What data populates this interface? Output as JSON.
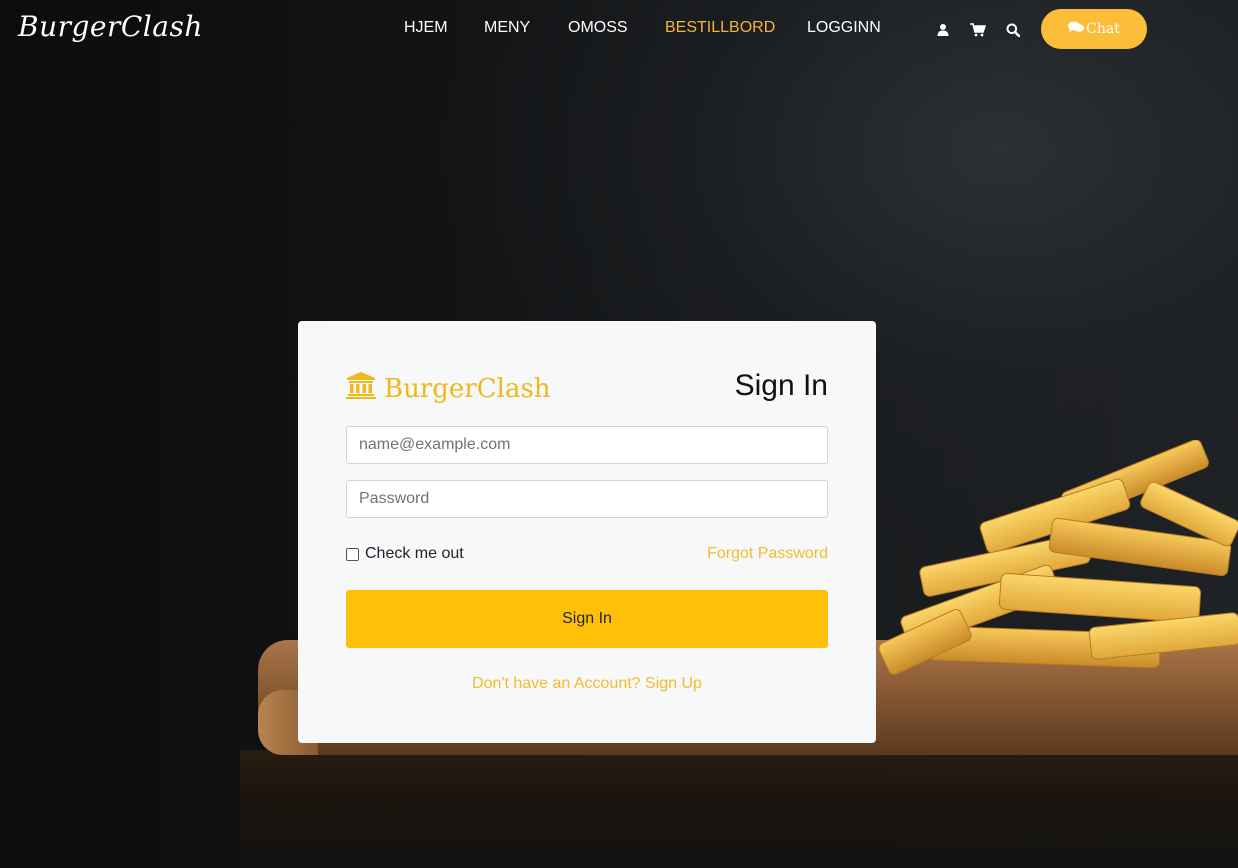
{
  "header": {
    "brand": "BurgerClash",
    "nav": [
      "HJEM",
      "MENY",
      "OMOSS",
      "BESTILLBORD",
      "LOGGINN"
    ],
    "active_nav": "BESTILLBORD",
    "icons": [
      "user-icon",
      "cart-icon",
      "search-icon"
    ],
    "chat_label": "Chat"
  },
  "card": {
    "logo_text": "BurgerClash",
    "title": "Sign In",
    "email_placeholder": "name@example.com",
    "password_placeholder": "Password",
    "remember_label": "Check me out",
    "forgot_label": "Forgot Password",
    "submit_label": "Sign In",
    "signup_label": "Don't have an Account? Sign Up"
  },
  "colors": {
    "accent": "#ffc107",
    "nav_active": "#f3b53b",
    "chat_button": "#fcbd39",
    "card_bg": "#f7f8f9"
  }
}
